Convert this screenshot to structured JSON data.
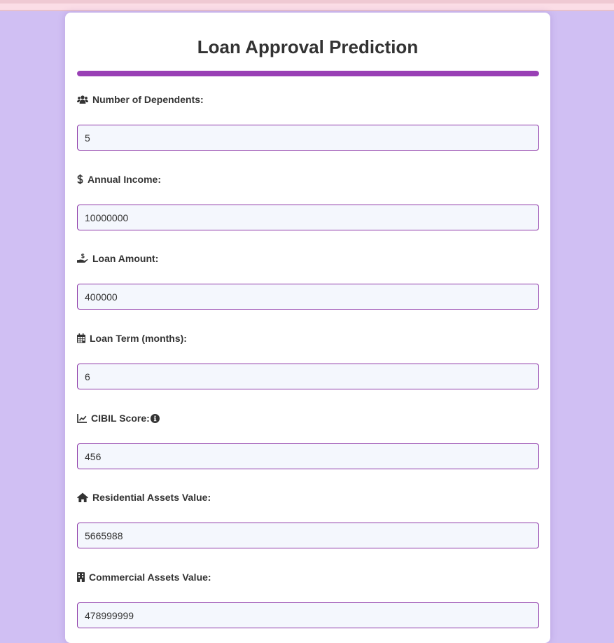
{
  "title": "Loan Approval Prediction",
  "progress": {
    "fraction": 1.0,
    "color": "#9940b5"
  },
  "fields": [
    {
      "label": "Number of Dependents:",
      "value": "5",
      "icon": "users-icon"
    },
    {
      "label": "Annual Income:",
      "value": "10000000",
      "icon": "dollar-icon"
    },
    {
      "label": "Loan Amount:",
      "value": "400000",
      "icon": "hand-holding-dollar-icon"
    },
    {
      "label": "Loan Term (months):",
      "value": "6",
      "icon": "calendar-icon"
    },
    {
      "label": "CIBIL Score:",
      "value": "456",
      "icon": "chart-line-icon",
      "info_icon": "info-circle-icon"
    },
    {
      "label": "Residential Assets Value:",
      "value": "5665988",
      "icon": "home-icon"
    },
    {
      "label": "Commercial Assets Value:",
      "value": "478999999",
      "icon": "building-icon"
    }
  ],
  "colors": {
    "background": "#d0bff3",
    "accent": "#9940b5",
    "input_border": "#8e3aa9",
    "input_background": "#f4f7fd"
  }
}
